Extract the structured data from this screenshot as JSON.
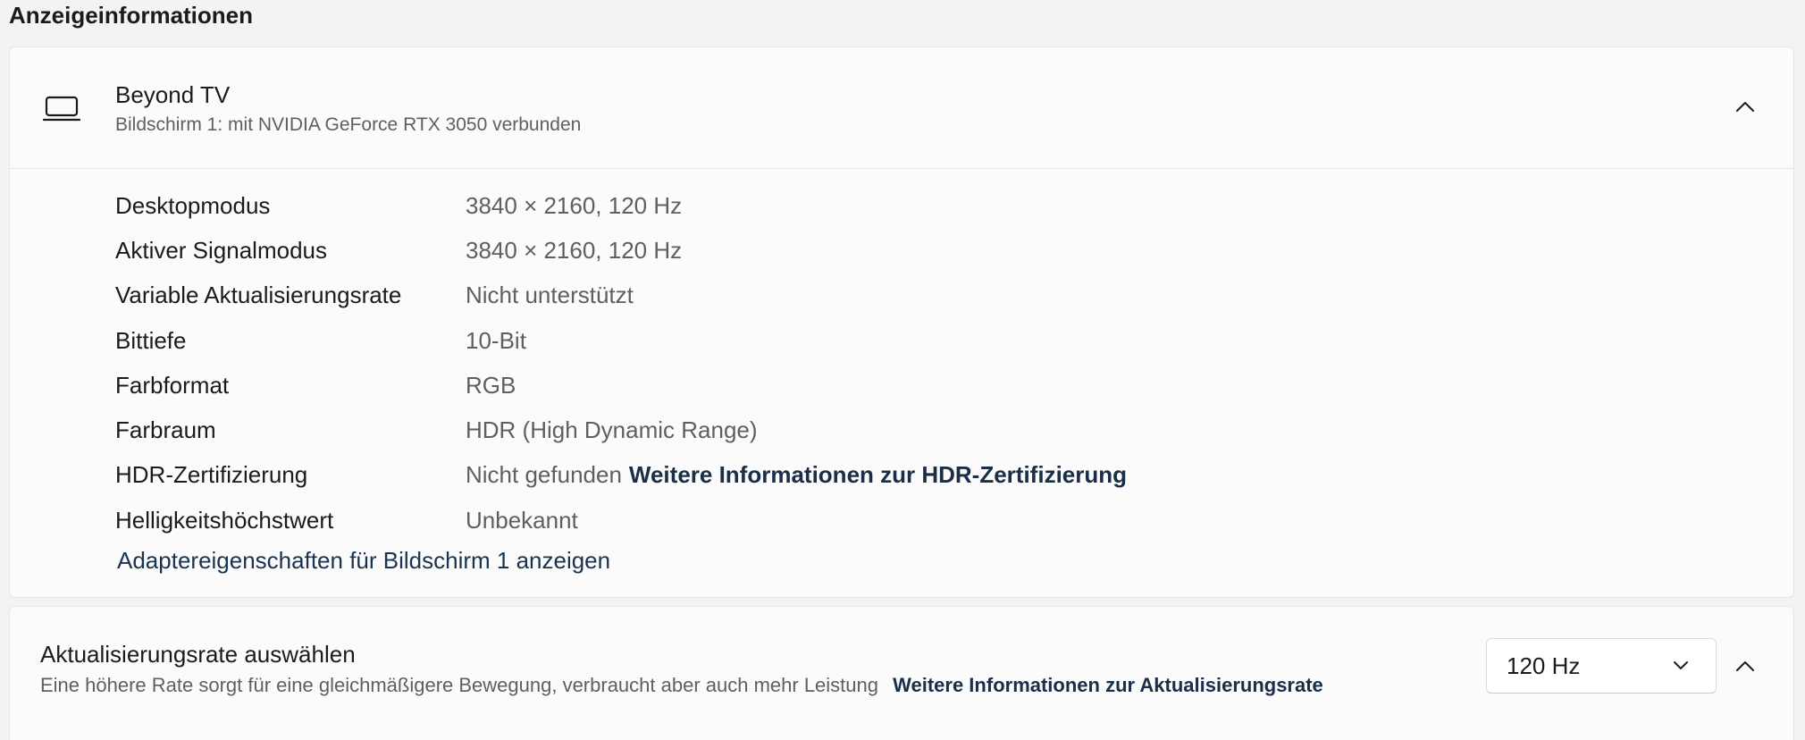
{
  "section": {
    "title": "Anzeigeinformationen"
  },
  "display": {
    "name": "Beyond TV",
    "subtitle": "Bildschirm 1: mit NVIDIA GeForce RTX 3050 verbunden",
    "icon": "laptop-icon",
    "expanded": true,
    "properties": [
      {
        "label": "Desktopmodus",
        "value": "3840 × 2160, 120 Hz"
      },
      {
        "label": "Aktiver Signalmodus",
        "value": "3840 × 2160, 120 Hz"
      },
      {
        "label": "Variable Aktualisierungsrate",
        "value": "Nicht unterstützt"
      },
      {
        "label": "Bittiefe",
        "value": "10-Bit"
      },
      {
        "label": "Farbformat",
        "value": "RGB"
      },
      {
        "label": "Farbraum",
        "value": "HDR (High Dynamic Range)"
      },
      {
        "label": "HDR-Zertifizierung",
        "value": "Nicht gefunden",
        "link": "Weitere Informationen zur HDR-Zertifizierung"
      },
      {
        "label": "Helligkeitshöchstwert",
        "value": "Unbekannt"
      }
    ],
    "adapter_link": "Adaptereigenschaften für Bildschirm 1 anzeigen"
  },
  "refresh_rate": {
    "title": "Aktualisierungsrate auswählen",
    "description": "Eine höhere Rate sorgt für eine gleichmäßigere Bewegung, verbraucht aber auch mehr Leistung",
    "link": "Weitere Informationen zur Aktualisierungsrate",
    "selected": "120 Hz"
  }
}
